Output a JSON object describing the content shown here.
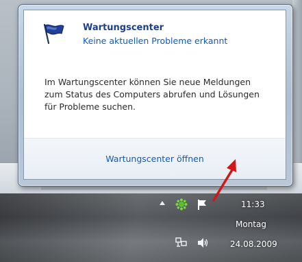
{
  "popup": {
    "title": "Wartungscenter",
    "subtitle": "Keine aktuellen Probleme erkannt",
    "body": "Im Wartungscenter können Sie neue Meldungen zum Status des Computers abrufen und Lösungen für Probleme suchen.",
    "open_link": "Wartungscenter öffnen"
  },
  "tray": {
    "time": "11:33",
    "day": "Montag",
    "date": "24.08.2009"
  },
  "icons": {
    "flag": "action-center-flag-icon",
    "tray": [
      "show-hidden-icons-chevron",
      "green-app-icon",
      "action-center-flag-icon",
      "network-icon",
      "speaker-icon"
    ]
  },
  "colors": {
    "title": "#1b3f8f",
    "link": "#0b5cc7",
    "arrow": "#d01818"
  }
}
